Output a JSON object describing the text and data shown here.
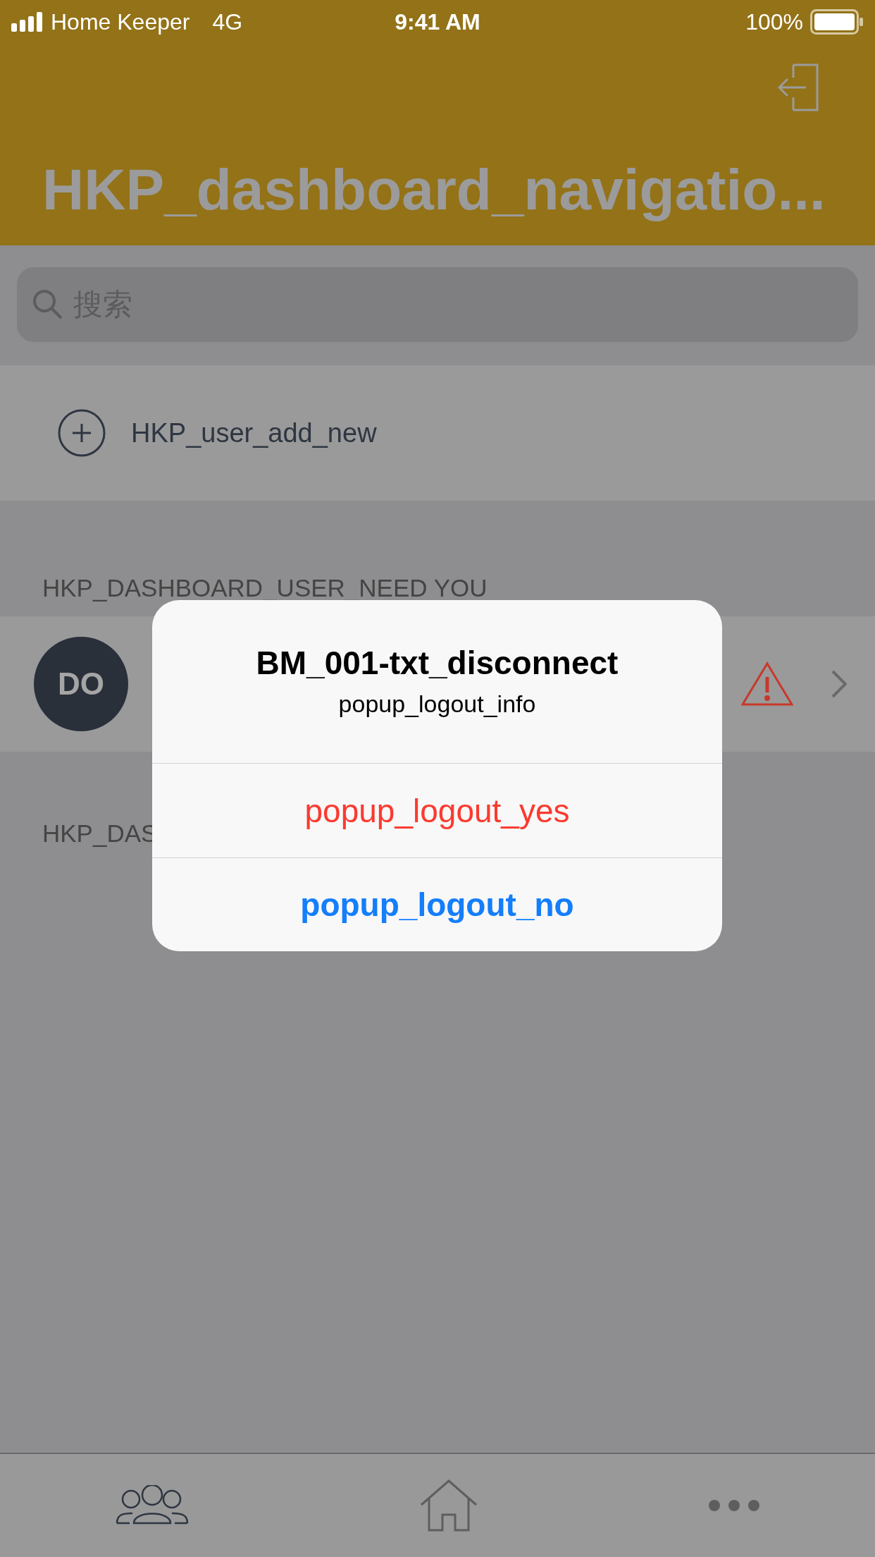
{
  "status_bar": {
    "carrier": "Home Keeper",
    "network": "4G",
    "time": "9:41 AM",
    "battery": "100%"
  },
  "header": {
    "title": "HKP_dashboard_navigatio..."
  },
  "search": {
    "placeholder": "搜索"
  },
  "add_user": {
    "label": "HKP_user_add_new"
  },
  "sections": [
    {
      "title": "HKP_DASHBOARD_USER_NEED YOU",
      "users": [
        {
          "initials": "DO",
          "warning": true
        }
      ]
    },
    {
      "title": "HKP_DAS"
    }
  ],
  "dialog": {
    "title": "BM_001-txt_disconnect",
    "message": "popup_logout_info",
    "actions": [
      {
        "label": "popup_logout_yes",
        "kind": "destructive"
      },
      {
        "label": "popup_logout_no",
        "kind": "default"
      }
    ]
  },
  "tab_bar": {
    "tabs": [
      {
        "kind": "users"
      },
      {
        "kind": "home"
      },
      {
        "kind": "more"
      }
    ]
  }
}
